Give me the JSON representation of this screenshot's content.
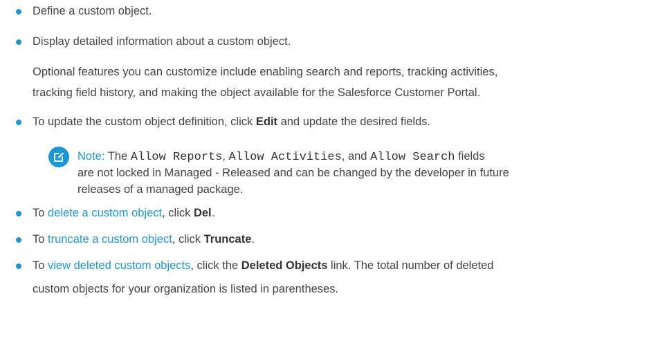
{
  "colors": {
    "accent": "#1b96d8",
    "text": "#444444"
  },
  "items": [
    {
      "text": "Define a custom object."
    },
    {
      "text": "Display detailed information about a custom object."
    }
  ],
  "optional_paragraph": [
    "Optional features you can customize include enabling search and reports, tracking activities,",
    "tracking field history, and making the object available for the Salesforce Customer Portal."
  ],
  "update_item": {
    "prefix": "To update the custom object definition, click ",
    "bold": "Edit",
    "suffix": " and update the desired fields."
  },
  "note": {
    "icon": "edit-note-icon",
    "label": "Note:",
    "t1": " The ",
    "code1": "Allow Reports",
    "t2": ", ",
    "code2": "Allow Activities",
    "t3": ", and ",
    "code3": "Allow Search",
    "t4": " fields",
    "line2": "are not locked in Managed - Released and can be changed by the developer in future",
    "line3": "releases of a managed package."
  },
  "delete_item": {
    "prefix": "To ",
    "link": "delete a custom object",
    "middle": ", click ",
    "bold": "Del",
    "suffix": "."
  },
  "truncate_item": {
    "prefix": "To ",
    "link": "truncate a custom object",
    "middle": ", click ",
    "bold": "Truncate",
    "suffix": "."
  },
  "deleted_item": {
    "prefix": "To ",
    "link": "view deleted custom objects",
    "middle": ", click the ",
    "bold": "Deleted Objects",
    "suffix": " link. The total number of deleted",
    "line2": "custom objects for your organization is listed in parentheses."
  }
}
